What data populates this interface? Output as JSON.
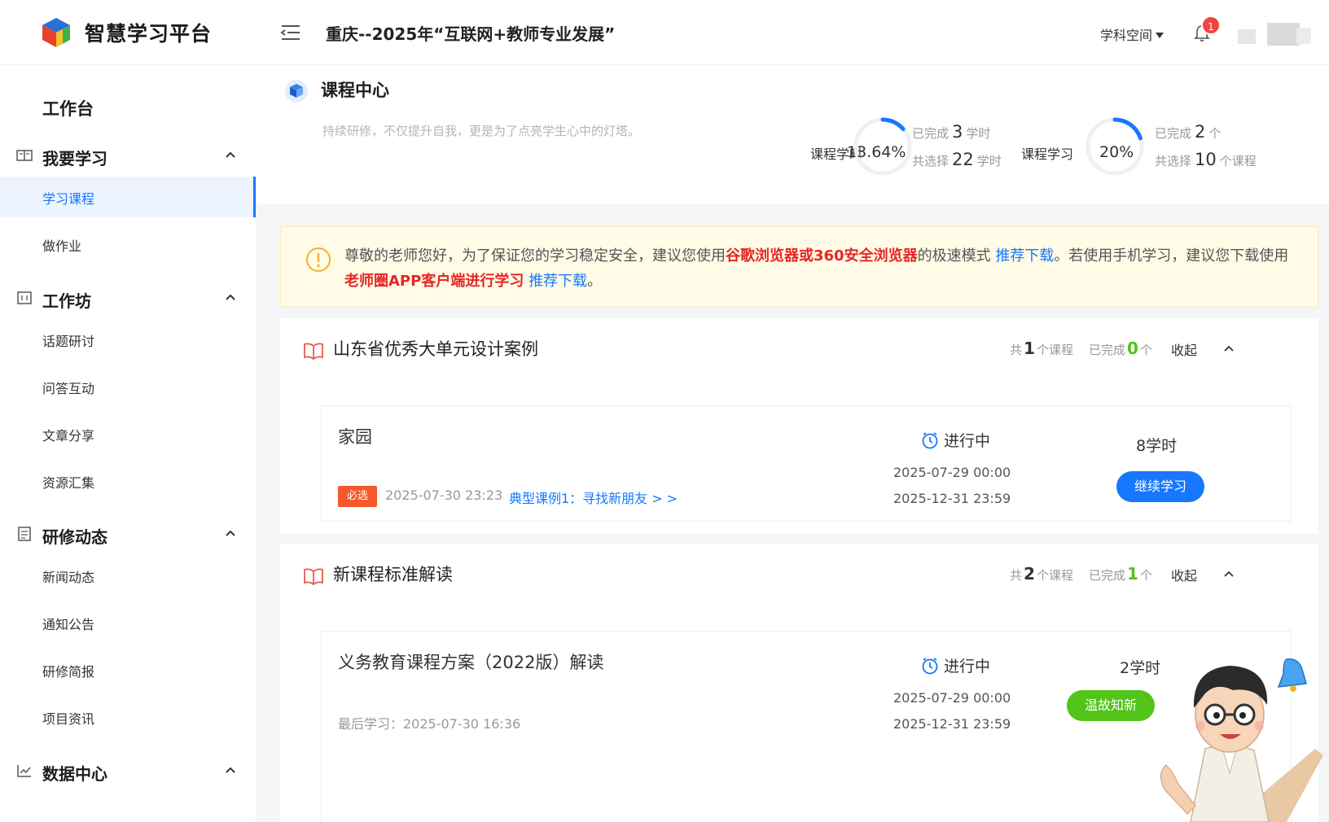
{
  "header": {
    "brand": "智慧学习平台",
    "project_title": "重庆--2025年“互联网+教师专业发展”",
    "subject_space": "学科空间",
    "notification_count": "1"
  },
  "sidebar": {
    "workbench": "工作台",
    "groups": [
      {
        "label": "我要学习",
        "items": [
          "学习课程",
          "做作业"
        ]
      },
      {
        "label": "工作坊",
        "items": [
          "话题研讨",
          "问答互动",
          "文章分享",
          "资源汇集"
        ]
      },
      {
        "label": "研修动态",
        "items": [
          "新闻动态",
          "通知公告",
          "研修简报",
          "项目资讯"
        ]
      },
      {
        "label": "数据中心",
        "items": []
      }
    ]
  },
  "page": {
    "title": "课程中心",
    "subtitle": "持续研修，不仅提升自我，更是为了点亮学生心中的灯塔。"
  },
  "stats": {
    "hours": {
      "label": "课程学时",
      "percent_text": "13.64%",
      "progress": 0.1364,
      "completed_prefix": "已完成",
      "completed": "3",
      "completed_unit": "学时",
      "selected_prefix": "共选择",
      "selected": "22",
      "selected_unit": "学时"
    },
    "courses": {
      "label": "课程学习",
      "percent_text": "20%",
      "progress": 0.2,
      "completed_prefix": "已完成",
      "completed": "2",
      "completed_unit": "个",
      "selected_prefix": "共选择",
      "selected": "10",
      "selected_unit": "个课程"
    }
  },
  "notice": {
    "t1": "尊敬的老师您好，为了保证您的学习稳定安全，建议您使用",
    "r1": "谷歌浏览器或360安全浏览器",
    "t2": "的极速模式 ",
    "l1": "推荐下载",
    "t3": "。若使用手机学习，建议您下载使用",
    "r2": "老师圈APP客户端进行学习",
    "t4": " ",
    "l2": "推荐下载",
    "t5": "。"
  },
  "sections": [
    {
      "title": "山东省优秀大单元设计案例",
      "total_prefix": "共",
      "total": "1",
      "total_unit": "个课程",
      "done_prefix": "已完成",
      "done": "0",
      "done_unit": "个",
      "collapse": "收起",
      "course": {
        "title": "家园",
        "tag": "必选",
        "last": "2025-07-30 23:23",
        "link": "典型课例1：寻找新朋友 > >",
        "status": "进行中",
        "start": "2025-07-29 00:00",
        "end": "2025-12-31 23:59",
        "hours": "8学时",
        "button": "继续学习"
      }
    },
    {
      "title": "新课程标准解读",
      "total_prefix": "共",
      "total": "2",
      "total_unit": "个课程",
      "done_prefix": "已完成",
      "done": "1",
      "done_unit": "个",
      "collapse": "收起",
      "course": {
        "title": "义务教育课程方案（2022版）解读",
        "last": "最后学习：2025-07-30 16:36",
        "status": "进行中",
        "start": "2025-07-29 00:00",
        "end": "2025-12-31 23:59",
        "hours": "2学时",
        "button": "温故知新"
      }
    }
  ],
  "colors": {
    "accent": "#1677ff",
    "success": "#52c41a",
    "danger": "#e62626",
    "required_tag": "#f5582a",
    "notice_bg": "#fffbe6"
  }
}
